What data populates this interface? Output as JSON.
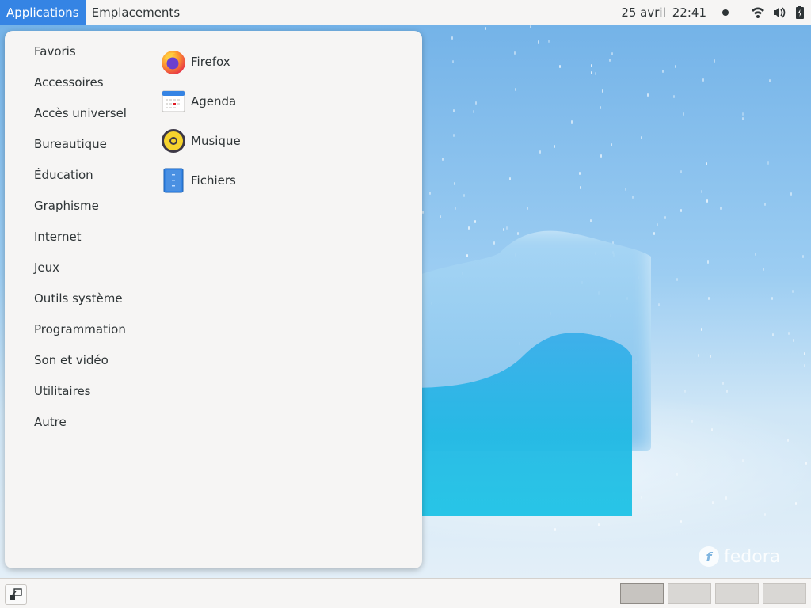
{
  "top_panel": {
    "applications_label": "Applications",
    "places_label": "Emplacements",
    "date": "25 avril",
    "time": "22:41",
    "icons": [
      "notification-dot-icon",
      "wifi-icon",
      "volume-icon",
      "battery-icon"
    ]
  },
  "menu": {
    "categories": [
      {
        "label": "Favoris"
      },
      {
        "label": "Accessoires"
      },
      {
        "label": "Accès universel"
      },
      {
        "label": "Bureautique"
      },
      {
        "label": "Éducation"
      },
      {
        "label": "Graphisme"
      },
      {
        "label": "Internet"
      },
      {
        "label": "Jeux"
      },
      {
        "label": "Outils système"
      },
      {
        "label": "Programmation"
      },
      {
        "label": "Son et vidéo"
      },
      {
        "label": "Utilitaires"
      },
      {
        "label": "Autre"
      }
    ],
    "apps": [
      {
        "label": "Firefox",
        "icon": "firefox-icon"
      },
      {
        "label": "Agenda",
        "icon": "calendar-icon"
      },
      {
        "label": "Musique",
        "icon": "music-icon"
      },
      {
        "label": "Fichiers",
        "icon": "files-icon"
      }
    ]
  },
  "desktop": {
    "brand": "fedora"
  },
  "bottom_panel": {
    "workspaces": [
      {
        "active": true
      },
      {
        "active": false
      },
      {
        "active": false
      },
      {
        "active": false
      }
    ]
  },
  "colors": {
    "accent": "#3584e4",
    "panel_bg": "#f6f5f4",
    "text": "#2e3436"
  }
}
